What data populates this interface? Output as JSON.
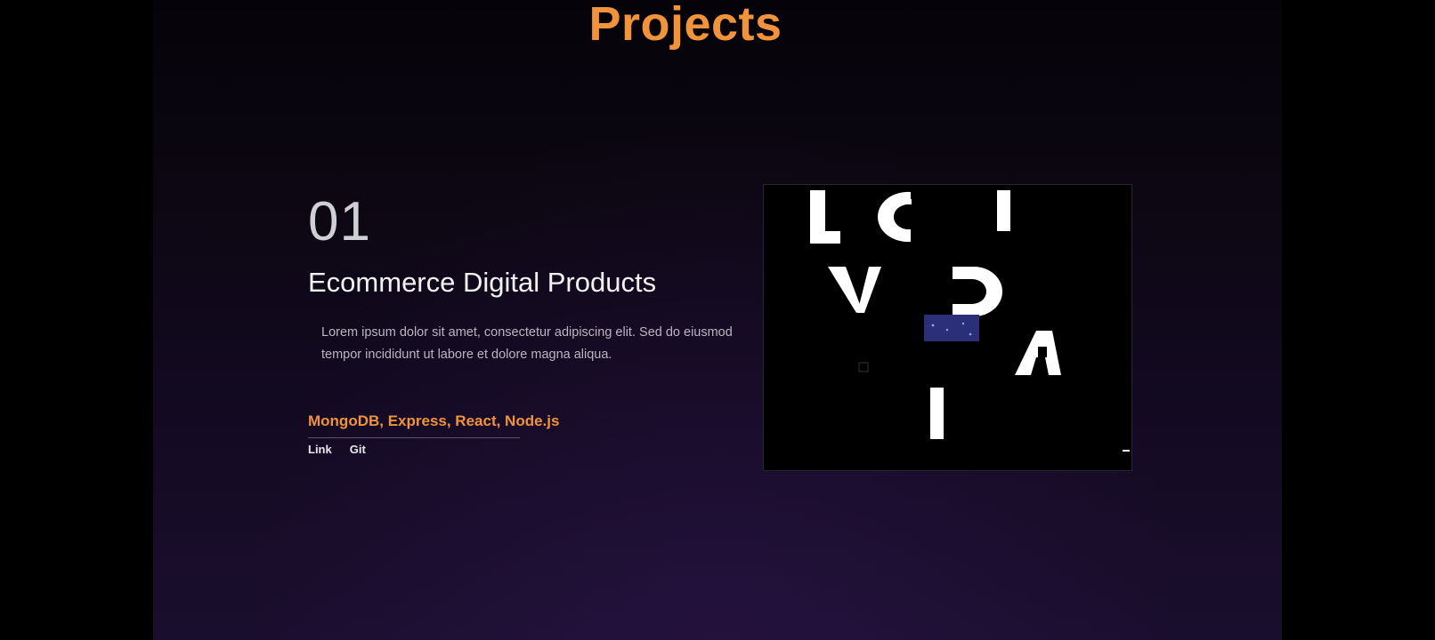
{
  "section": {
    "title": "Projects"
  },
  "project": {
    "number": "01",
    "name": "Ecommerce Digital Products",
    "description": "Lorem ipsum dolor sit amet, consectetur adipiscing elit. Sed do eiusmod tempor incididunt ut labore et dolore magna aliqua.",
    "tech_stack": "MongoDB, Express, React, Node.js",
    "links": {
      "live_label": "Link",
      "git_label": "Git"
    },
    "preview": {
      "icon": "glitch-letters-preview"
    }
  },
  "colors": {
    "accent": "#f0933a",
    "text": "#f2f2f5",
    "muted": "#b9b6c2",
    "background": "#130a22"
  }
}
